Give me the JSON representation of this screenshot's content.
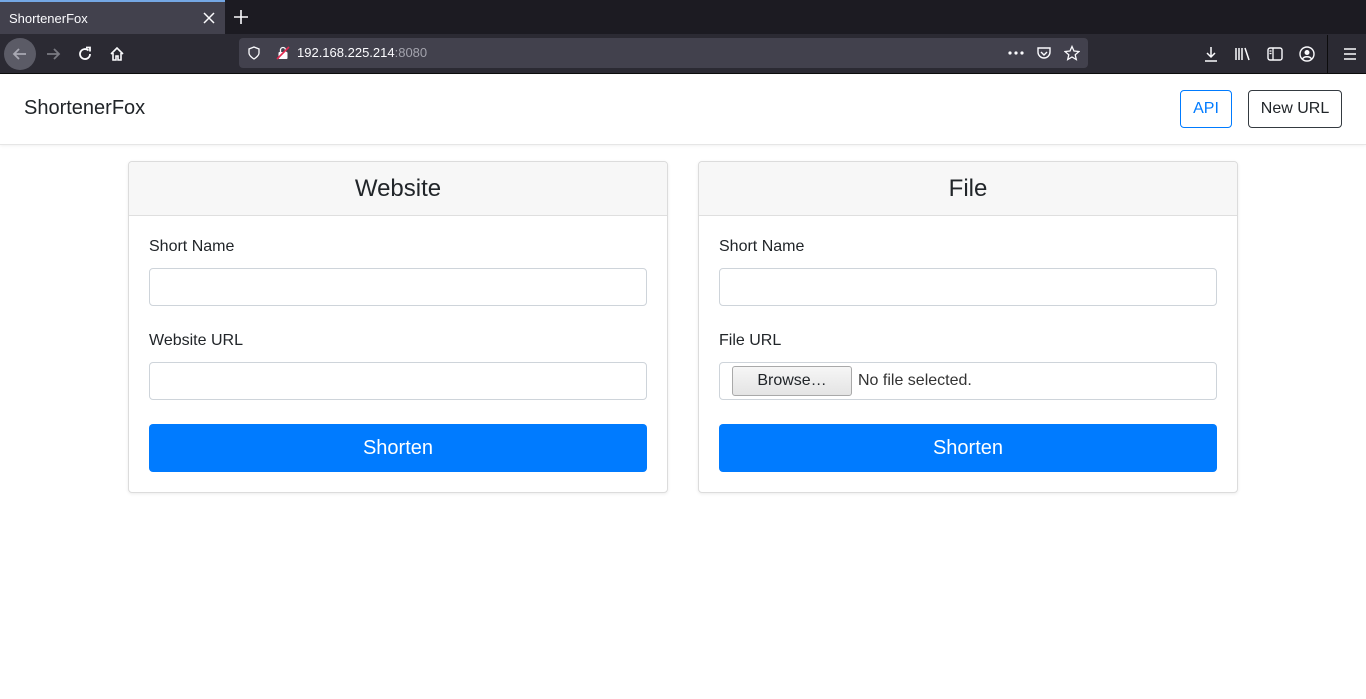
{
  "browser": {
    "tab_title": "ShortenerFox",
    "url_host": "192.168.225.214",
    "url_port": ":8080",
    "icons": [
      "close-icon",
      "plus-icon",
      "back-icon",
      "forward-icon",
      "reload-icon",
      "home-icon",
      "shield-icon",
      "insecure-lock-icon",
      "more-icon",
      "pocket-icon",
      "star-icon",
      "download-icon",
      "library-icon",
      "sidebar-icon",
      "account-icon",
      "menu-icon"
    ]
  },
  "site": {
    "brand": "ShortenerFox",
    "api_label": "API",
    "new_url_label": "New URL",
    "accent": "#007bff"
  },
  "website_card": {
    "title": "Website",
    "short_name_label": "Short Name",
    "short_name_value": "",
    "url_label": "Website URL",
    "url_value": "",
    "submit_label": "Shorten"
  },
  "file_card": {
    "title": "File",
    "short_name_label": "Short Name",
    "short_name_value": "",
    "file_label": "File URL",
    "browse_label": "Browse…",
    "file_status": "No file selected.",
    "submit_label": "Shorten"
  }
}
